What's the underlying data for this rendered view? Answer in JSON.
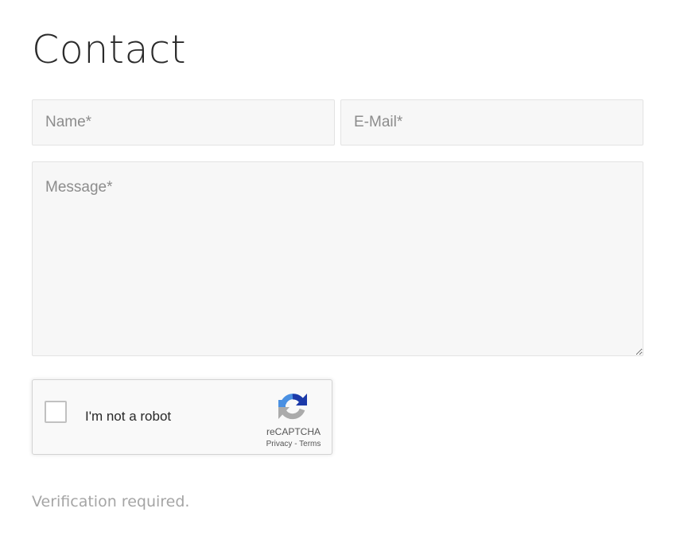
{
  "page": {
    "title": "Contact"
  },
  "form": {
    "name": {
      "value": "",
      "placeholder": "Name*"
    },
    "email": {
      "value": "",
      "placeholder": "E-Mail*"
    },
    "message": {
      "value": "",
      "placeholder": "Message*"
    }
  },
  "recaptcha": {
    "checkbox_label": "I'm not a robot",
    "brand": "reCAPTCHA",
    "privacy_label": "Privacy",
    "separator": " - ",
    "terms_label": "Terms",
    "checked": false,
    "logo_icon": "recaptcha-logo-icon"
  },
  "status": {
    "verification_message": "Verification required."
  },
  "colors": {
    "field_background": "#f7f7f7",
    "placeholder_text": "#8c8c8c",
    "status_text": "#a5a5a5",
    "recaptcha_blue": "#1c3aa9",
    "recaptcha_light_blue": "#4a90e2",
    "recaptcha_gray": "#ababab"
  }
}
